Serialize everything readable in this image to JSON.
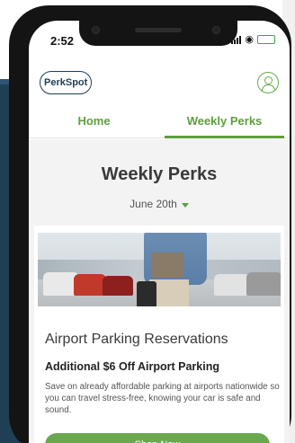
{
  "status_bar": {
    "time": "2:52"
  },
  "header": {
    "logo_text": "PerkSpot"
  },
  "nav": {
    "tabs": [
      {
        "label": "Home",
        "active": false
      },
      {
        "label": "Weekly Perks",
        "active": true
      }
    ]
  },
  "page": {
    "title": "Weekly Perks",
    "date_selected": "June 20th"
  },
  "card": {
    "title": "Airport Parking Reservations",
    "subtitle": "Additional $6 Off Airport Parking",
    "description": "Save on already affordable parking at airports nationwide so you can travel stress-free, knowing your car is safe and sound.",
    "button_label": "Shop Now"
  },
  "colors": {
    "accent_green": "#6aa84f",
    "brand_navy": "#1f3f57"
  },
  "icons": {
    "profile": "user-icon",
    "date_caret": "chevron-down-icon",
    "wifi": "wifi-icon",
    "battery": "battery-icon",
    "signal": "signal-icon"
  }
}
